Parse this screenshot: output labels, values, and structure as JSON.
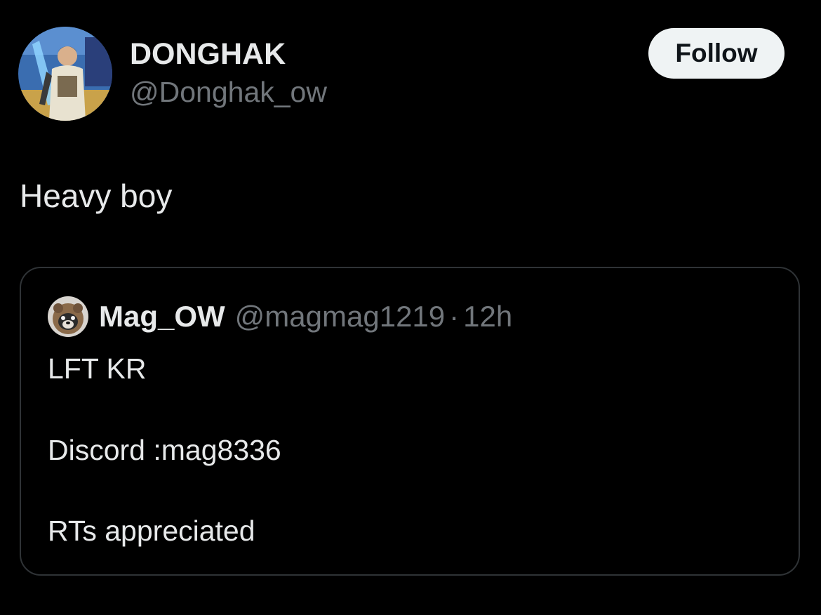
{
  "tweet": {
    "author": {
      "display_name": "DONGHAK",
      "handle": "@Donghak_ow",
      "avatar_icon": "profile-photo"
    },
    "follow_button_label": "Follow",
    "text": "Heavy boy",
    "quoted_tweet": {
      "author": {
        "display_name": "Mag_OW",
        "handle": "@magmag1219",
        "avatar_icon": "dog-photo"
      },
      "separator": "·",
      "time": "12h",
      "lines": [
        "LFT KR",
        "Discord :mag8336",
        "RTs appreciated"
      ]
    }
  },
  "colors": {
    "background": "#000000",
    "primary_text": "#e7e9ea",
    "secondary_text": "#71767b",
    "border": "#2f3336",
    "follow_button_bg": "#eff3f4",
    "follow_button_text": "#0f1419"
  }
}
